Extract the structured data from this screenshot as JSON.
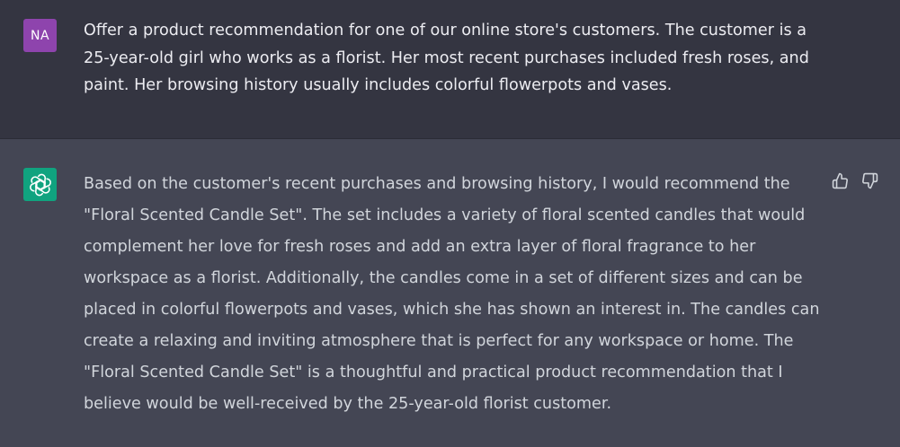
{
  "user_message": {
    "avatar_initials": "NA",
    "text": "Offer a product recommendation for one of our online store's customers. The customer is a 25-year-old girl who works as a florist. Her most recent purchases included fresh roses, and paint. Her browsing history usually includes colorful flowerpots and vases."
  },
  "assistant_message": {
    "avatar_icon": "openai-logo-icon",
    "text": "Based on the customer's recent purchases and browsing history, I would recommend the \"Floral Scented Candle Set\". The set includes a variety of floral scented candles that would complement her love for fresh roses and add an extra layer of floral fragrance to her workspace as a florist. Additionally, the candles come in a set of different sizes and can be placed in colorful flowerpots and vases, which she has shown an interest in. The candles can create a relaxing and inviting atmosphere that is perfect for any workspace or home. The \"Floral Scented Candle Set\" is a thoughtful and practical product recommendation that I believe would be well-received by the 25-year-old florist customer.",
    "actions": {
      "thumbs_up_icon": "thumbs-up-icon",
      "thumbs_down_icon": "thumbs-down-icon"
    }
  },
  "colors": {
    "user_bg": "#343541",
    "assistant_bg": "#444654",
    "user_avatar": "#8e44ad",
    "assistant_avatar": "#10a37f",
    "user_text": "#ececf1",
    "assistant_text": "#d1d5db"
  }
}
